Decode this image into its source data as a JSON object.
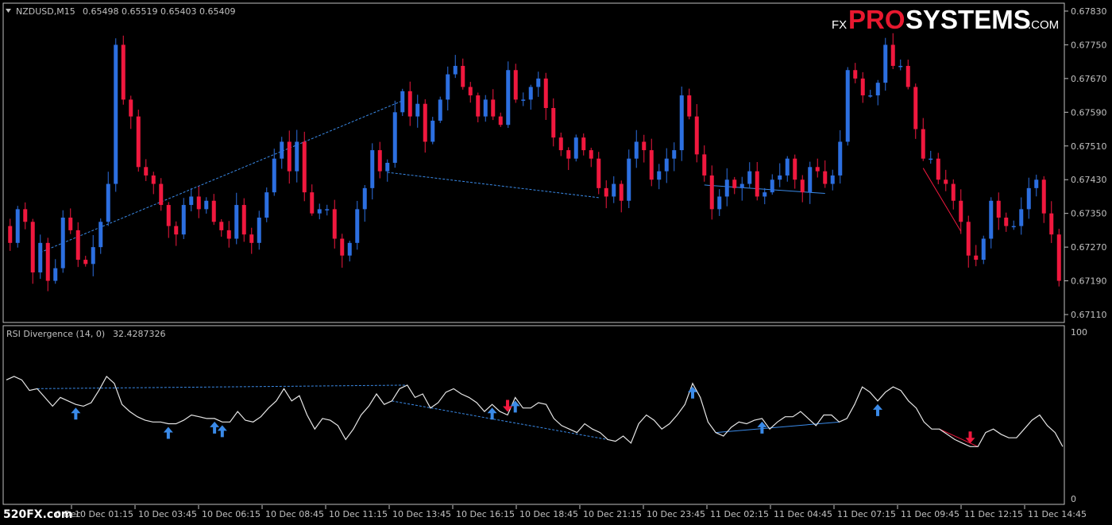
{
  "chart_header": {
    "symbol_timeframe": "NZDUSD,M15",
    "ohlc_readout": "0.65498 0.65519 0.65403 0.65409"
  },
  "watermark": {
    "fx": "FX",
    "pro": "PRO",
    "systems": "SYSTEMS",
    "com": ".COM"
  },
  "site_logo": "520FX.com",
  "indicator": {
    "name": "RSI Divergence (14, 0)",
    "value": "32.4287326",
    "level_top": "100",
    "level_bottom": "0"
  },
  "colors": {
    "background": "#000000",
    "bull_candle": "#2c6fe0",
    "bear_candle": "#f0183e",
    "rsi_line": "#e6e6e6",
    "bull_divergence": "#3a8ae8",
    "bear_divergence": "#f0183e",
    "grid_border": "#c0c0c0"
  },
  "chart_data": [
    {
      "type": "candlestick",
      "symbol": "NZDUSD",
      "timeframe": "M15",
      "y_ticks": [
        "0.67830",
        "0.67750",
        "0.67670",
        "0.67590",
        "0.67510",
        "0.67430",
        "0.67350",
        "0.67270",
        "0.67190",
        "0.67110"
      ],
      "ylim": [
        0.67095,
        0.67845
      ],
      "x_ticks": [
        "10 Dec 01:15",
        "10 Dec 03:45",
        "10 Dec 06:15",
        "10 Dec 08:45",
        "10 Dec 11:15",
        "10 Dec 13:45",
        "10 Dec 16:15",
        "10 Dec 18:45",
        "10 Dec 21:15",
        "10 Dec 23:45",
        "11 Dec 02:15",
        "11 Dec 04:45",
        "11 Dec 07:15",
        "11 Dec 09:45",
        "11 Dec 12:15",
        "11 Dec 14:45"
      ],
      "x_tick_first_partial": "0 Dec",
      "closes": [
        0.6728,
        0.6736,
        0.6733,
        0.6721,
        0.6728,
        0.6719,
        0.6722,
        0.6734,
        0.6731,
        0.6724,
        0.6723,
        0.6727,
        0.6733,
        0.6742,
        0.6775,
        0.6762,
        0.6758,
        0.6746,
        0.6744,
        0.6742,
        0.6737,
        0.6732,
        0.673,
        0.6737,
        0.6739,
        0.6736,
        0.6738,
        0.6733,
        0.6731,
        0.6729,
        0.6737,
        0.673,
        0.6728,
        0.6734,
        0.674,
        0.6748,
        0.6752,
        0.6745,
        0.6752,
        0.674,
        0.6735,
        0.6736,
        0.6736,
        0.6729,
        0.6725,
        0.6728,
        0.6736,
        0.6741,
        0.675,
        0.6745,
        0.6747,
        0.6759,
        0.6764,
        0.6758,
        0.6761,
        0.6752,
        0.6757,
        0.6762,
        0.6768,
        0.677,
        0.6765,
        0.6763,
        0.6758,
        0.6762,
        0.6758,
        0.6756,
        0.6769,
        0.6762,
        0.6762,
        0.6765,
        0.6767,
        0.676,
        0.6753,
        0.675,
        0.6748,
        0.6753,
        0.675,
        0.6748,
        0.6741,
        0.6739,
        0.6742,
        0.6738,
        0.6748,
        0.6752,
        0.675,
        0.6743,
        0.6745,
        0.6748,
        0.675,
        0.6763,
        0.6758,
        0.6749,
        0.6744,
        0.6736,
        0.6739,
        0.6743,
        0.6741,
        0.6742,
        0.6745,
        0.6739,
        0.674,
        0.6743,
        0.6744,
        0.6748,
        0.6743,
        0.674,
        0.6746,
        0.6745,
        0.6742,
        0.6744,
        0.6752,
        0.6769,
        0.6767,
        0.6763,
        0.6763,
        0.6766,
        0.6775,
        0.677,
        0.677,
        0.6765,
        0.6755,
        0.6748,
        0.6748,
        0.6743,
        0.6742,
        0.6738,
        0.6733,
        0.6725,
        0.6724,
        0.6729,
        0.6738,
        0.6734,
        0.6732,
        0.6732,
        0.6736,
        0.6741,
        0.6743,
        0.6735,
        0.673,
        0.6719
      ]
    },
    {
      "type": "line",
      "name": "RSI Divergence (14, 0)",
      "ylim": [
        0,
        100
      ],
      "values": [
        70,
        72,
        70,
        64,
        65,
        60,
        55,
        60,
        58,
        56,
        55,
        57,
        64,
        72,
        68,
        56,
        52,
        49,
        47,
        46,
        46,
        45,
        45,
        47,
        50,
        49,
        48,
        48,
        46,
        46,
        52,
        47,
        46,
        49,
        54,
        58,
        65,
        58,
        61,
        50,
        42,
        48,
        47,
        44,
        36,
        42,
        50,
        55,
        62,
        56,
        58,
        65,
        67,
        60,
        62,
        54,
        57,
        63,
        65,
        62,
        60,
        57,
        52,
        56,
        52,
        50,
        60,
        54,
        54,
        57,
        56,
        48,
        44,
        42,
        40,
        45,
        42,
        40,
        36,
        35,
        38,
        34,
        45,
        50,
        47,
        42,
        45,
        50,
        56,
        68,
        60,
        46,
        40,
        38,
        43,
        46,
        45,
        47,
        48,
        42,
        46,
        49,
        49,
        52,
        48,
        44,
        50,
        50,
        46,
        48,
        56,
        66,
        63,
        58,
        63,
        66,
        64,
        58,
        54,
        46,
        42,
        42,
        39,
        36,
        34,
        32,
        32,
        40,
        42,
        39,
        37,
        37,
        42,
        47,
        50,
        44,
        40,
        32
      ]
    }
  ]
}
